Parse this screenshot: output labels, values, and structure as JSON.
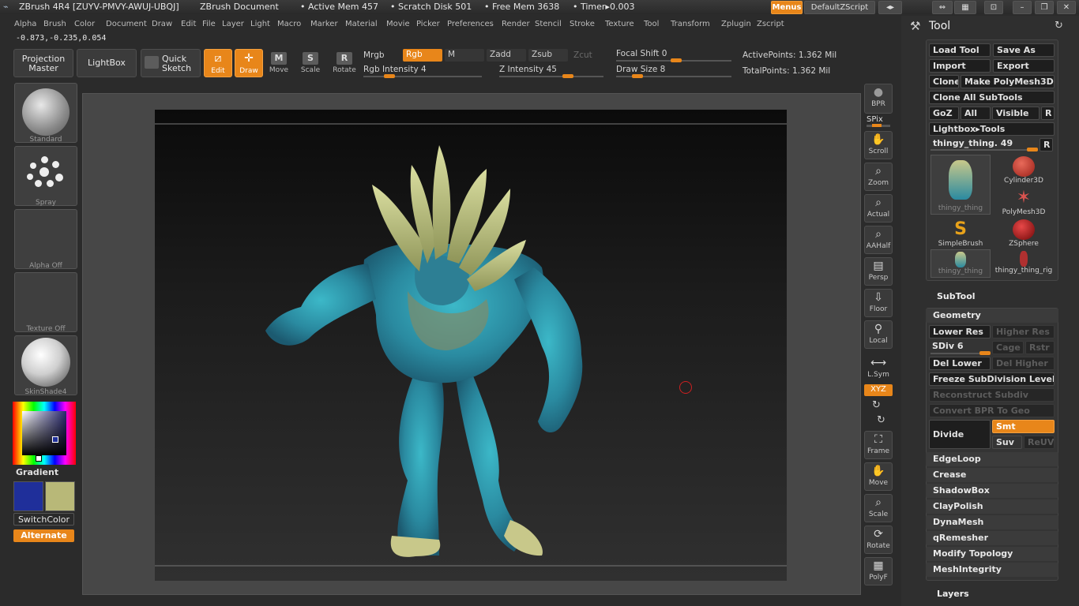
{
  "titlebar": {
    "app": "ZBrush 4R4 [ZUYV-PMVY-AWUJ-UBQJ]",
    "document": "ZBrush Document",
    "active_mem": "• Active Mem 457",
    "scratch": "• Scratch Disk 501",
    "free_mem": "• Free Mem 3638",
    "timer": "• Timer▸0.003",
    "menus_btn": "Menus",
    "script_btn": "DefaultZScript"
  },
  "menu": [
    "Alpha",
    "Brush",
    "Color",
    "Document",
    "Draw",
    "Edit",
    "File",
    "Layer",
    "Light",
    "Macro",
    "Marker",
    "Material",
    "Movie",
    "Picker",
    "Preferences",
    "Render",
    "Stencil",
    "Stroke",
    "Texture",
    "Tool",
    "Transform",
    "Zplugin",
    "Zscript"
  ],
  "coords": "-0.873,-0.235,0.054",
  "toolbar": {
    "projection_master": "Projection Master",
    "lightbox": "LightBox",
    "quick_sketch": "Quick Sketch",
    "edit": "Edit",
    "draw": "Draw",
    "move": "Move",
    "scale": "Scale",
    "rotate": "Rotate",
    "mrgb": "Mrgb",
    "rgb": "Rgb",
    "m": "M",
    "zadd": "Zadd",
    "zsub": "Zsub",
    "zcut": "Zcut",
    "rgb_intensity": "Rgb Intensity 4",
    "z_intensity": "Z Intensity 45",
    "focal_shift": "Focal Shift 0",
    "draw_size": "Draw Size 8",
    "active_points": "ActivePoints: 1.362 Mil",
    "total_points": "TotalPoints: 1.362 Mil"
  },
  "shelf": {
    "brush": "Standard",
    "stroke": "Spray",
    "alpha": "Alpha Off",
    "texture": "Texture Off",
    "material": "SkinShade4",
    "gradient": "Gradient",
    "switch_color": "SwitchColor",
    "alternate": "Alternate",
    "colors": {
      "primary": "#1f2f9a",
      "secondary": "#b8b878"
    }
  },
  "right_tools": [
    {
      "name": "bpr",
      "label": "BPR"
    },
    {
      "name": "spix",
      "label": "SPix"
    },
    {
      "name": "scroll",
      "label": "Scroll"
    },
    {
      "name": "zoom",
      "label": "Zoom"
    },
    {
      "name": "actual",
      "label": "Actual"
    },
    {
      "name": "aahalf",
      "label": "AAHalf"
    },
    {
      "name": "persp",
      "label": "Persp"
    },
    {
      "name": "floor",
      "label": "Floor"
    },
    {
      "name": "local",
      "label": "Local"
    },
    {
      "name": "lsym",
      "label": "L.Sym"
    },
    {
      "name": "xyz",
      "label": "XYZ"
    },
    {
      "name": "frame",
      "label": "Frame"
    },
    {
      "name": "move",
      "label": "Move"
    },
    {
      "name": "scale",
      "label": "Scale"
    },
    {
      "name": "rotate",
      "label": "Rotate"
    },
    {
      "name": "polyf",
      "label": "PolyF"
    }
  ],
  "tool_panel": {
    "title": "Tool",
    "load_tool": "Load Tool",
    "save_as": "Save As",
    "import": "Import",
    "export": "Export",
    "clone": "Clone",
    "make_polymesh": "Make PolyMesh3D",
    "clone_all": "Clone All SubTools",
    "goz": "GoZ",
    "all": "All",
    "visible": "Visible",
    "r": "R",
    "lightbox_tools": "Lightbox▸Tools",
    "current_tool": "thingy_thing. 49",
    "thumbs": [
      {
        "name": "thingy_thing",
        "label": "thingy_thing",
        "color": "#3d7a8a"
      },
      {
        "name": "cylinder3d",
        "label": "Cylinder3D",
        "color": "#c0392b"
      },
      {
        "name": "polymesh3d",
        "label": "PolyMesh3D",
        "color": "#d9534f"
      },
      {
        "name": "simplebrush",
        "label": "SimpleBrush",
        "color": "#e8a21a"
      },
      {
        "name": "zsphere",
        "label": "ZSphere",
        "color": "#b01818"
      },
      {
        "name": "thingy_thing_2",
        "label": "thingy_thing",
        "color": "#3d7a8a"
      },
      {
        "name": "thingy_thing_rig",
        "label": "thingy_thing_rig",
        "color": "#b03030"
      }
    ],
    "subtool": "SubTool",
    "geometry": "Geometry",
    "lower_res": "Lower Res",
    "higher_res": "Higher Res",
    "sdiv": "SDiv 6",
    "cage": "Cage",
    "rstr": "Rstr",
    "del_lower": "Del Lower",
    "del_higher": "Del Higher",
    "freeze": "Freeze SubDivision Levels",
    "reconstruct": "Reconstruct Subdiv",
    "convert_bpr": "Convert BPR To Geo",
    "divide": "Divide",
    "smt": "Smt",
    "suv": "Suv",
    "reuv": "ReUV",
    "edgeloop": "EdgeLoop",
    "crease": "Crease",
    "shadowbox": "ShadowBox",
    "claypolish": "ClayPolish",
    "dynamesh": "DynaMesh",
    "qremesher": "qRemesher",
    "modify_topology": "Modify Topology",
    "meshintegrity": "MeshIntegrity",
    "layers": "Layers"
  }
}
